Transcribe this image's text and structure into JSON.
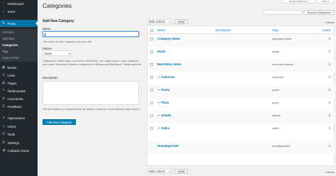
{
  "sidebar": {
    "items": [
      {
        "label": "Dashboard",
        "icon": "dashboard-icon",
        "glyph": "◔"
      },
      {
        "label": "Store",
        "icon": "store-icon",
        "glyph": "⌂"
      },
      {
        "label": "Posts",
        "icon": "pin-icon",
        "glyph": "✎"
      },
      {
        "label": "Media",
        "icon": "media-icon",
        "glyph": "▣"
      },
      {
        "label": "Links",
        "icon": "links-icon",
        "glyph": "⚲"
      },
      {
        "label": "Pages",
        "icon": "pages-icon",
        "glyph": "▤"
      },
      {
        "label": "Testimonials",
        "icon": "testimonials-icon",
        "glyph": "❝"
      },
      {
        "label": "Comments",
        "icon": "comments-icon",
        "glyph": "✉"
      },
      {
        "label": "Feedback",
        "icon": "feedback-icon",
        "glyph": "☰"
      },
      {
        "label": "Appearance",
        "icon": "appearance-icon",
        "glyph": "✦"
      },
      {
        "label": "Users",
        "icon": "users-icon",
        "glyph": "☺"
      },
      {
        "label": "Tools",
        "icon": "tools-icon",
        "glyph": "⚒"
      },
      {
        "label": "Settings",
        "icon": "settings-icon",
        "glyph": "⚙"
      },
      {
        "label": "Collapse menu",
        "icon": "collapse-icon",
        "glyph": "◀"
      }
    ],
    "submenu": [
      "All Posts",
      "Add New",
      "Categories",
      "Tags",
      "Copy a Post"
    ]
  },
  "screen_options": {
    "label": "Screen Options ▾"
  },
  "help": {
    "label": "Help ▾"
  },
  "page": {
    "title": "Categories"
  },
  "search": {
    "button": "Search Categories"
  },
  "form": {
    "heading": "Add New Category",
    "name_label": "Name",
    "name_desc": "The name is how it appears on your site.",
    "parent_label": "Parent",
    "parent_value": "None",
    "parent_desc": "Categories, unlike tags, can have a hierarchy. You might have a Jazz category, and under that have children categories for Bebop and Big Band. Totally optional.",
    "description_label": "Description",
    "description_desc": "The description is not prominent by default; however, some themes may show it.",
    "submit": "Add New Category"
  },
  "table": {
    "bulk_label": "Bulk Actions",
    "apply_label": "Apply",
    "items_count": "9 items",
    "columns": {
      "name": "Name",
      "description": "Description",
      "slug": "Slug",
      "count": "Count"
    },
    "rows": [
      {
        "name": "Company News",
        "slug": "company-news",
        "count": "0"
      },
      {
        "name": "Deals",
        "slug": "deals",
        "count": "0"
      },
      {
        "name": "New Menu Items",
        "slug": "new-menu-items",
        "count": "0"
      },
      {
        "name": "— Calzones",
        "slug": "calzones",
        "count": "0"
      },
      {
        "name": "— Pasta",
        "slug": "pasta",
        "count": "0"
      },
      {
        "name": "— Pizza",
        "slug": "pizza",
        "count": "0"
      },
      {
        "name": "— Salads",
        "slug": "salads",
        "count": "0"
      },
      {
        "name": "— Sides",
        "slug": "sides",
        "count": "0"
      },
      {
        "name": "Uncategorized",
        "slug": "uncategorized",
        "count": "1"
      }
    ]
  },
  "colors": {
    "sidebar": "#23282d",
    "accent": "#0073aa",
    "primary_button": "#0085ba"
  }
}
